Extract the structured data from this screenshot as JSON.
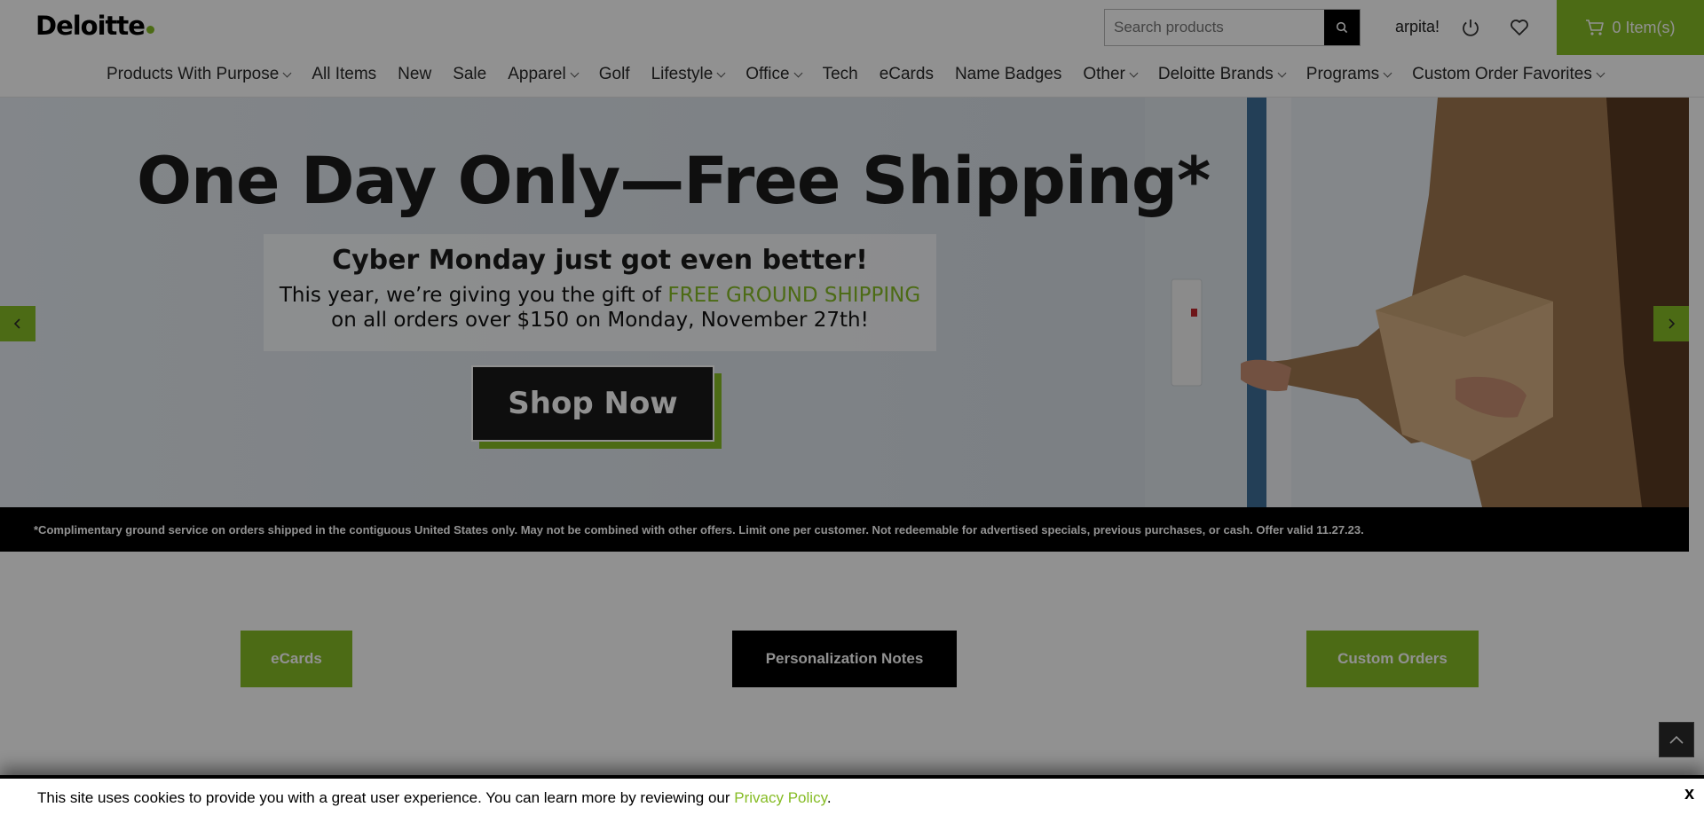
{
  "header": {
    "logo_text": "Deloitte",
    "search_placeholder": "Search products",
    "user_name": "arpita!",
    "cart_label": "0 Item(s)"
  },
  "nav": {
    "items": [
      {
        "label": "Products With Purpose",
        "dropdown": true
      },
      {
        "label": "All Items",
        "dropdown": false
      },
      {
        "label": "New",
        "dropdown": false
      },
      {
        "label": "Sale",
        "dropdown": false
      },
      {
        "label": "Apparel",
        "dropdown": true
      },
      {
        "label": "Golf",
        "dropdown": false
      },
      {
        "label": "Lifestyle",
        "dropdown": true
      },
      {
        "label": "Office",
        "dropdown": true
      },
      {
        "label": "Tech",
        "dropdown": false
      },
      {
        "label": "eCards",
        "dropdown": false
      },
      {
        "label": "Name Badges",
        "dropdown": false
      },
      {
        "label": "Other",
        "dropdown": true
      },
      {
        "label": "Deloitte Brands",
        "dropdown": true
      },
      {
        "label": "Programs",
        "dropdown": true
      },
      {
        "label": "Custom Order Favorites",
        "dropdown": true
      }
    ]
  },
  "hero": {
    "title": "One Day Only—Free Shipping*",
    "subtitle": "Cyber Monday just got even better!",
    "line1_prefix": "This year, we’re giving you the gift of ",
    "line1_highlight": "FREE GROUND SHIPPING",
    "line2": "on all orders over $150 on Monday, November 27th!",
    "cta_label": "Shop Now",
    "disclaimer": "*Complimentary ground service on orders shipped in the contiguous United States only. May not be combined with other offers. Limit one per customer. Not redeemable for advertised specials, previous purchases, or cash. Offer valid 11.27.23."
  },
  "quick_links": {
    "ecards": "eCards",
    "personalization": "Personalization Notes",
    "custom_orders": "Custom Orders"
  },
  "cookie": {
    "text": "This site uses cookies to provide you with a great user experience. You can learn more by reviewing our ",
    "link_label": "Privacy Policy",
    "suffix": ".",
    "close_label": "x"
  },
  "colors": {
    "brand_green": "#86bc25",
    "black": "#000000"
  }
}
